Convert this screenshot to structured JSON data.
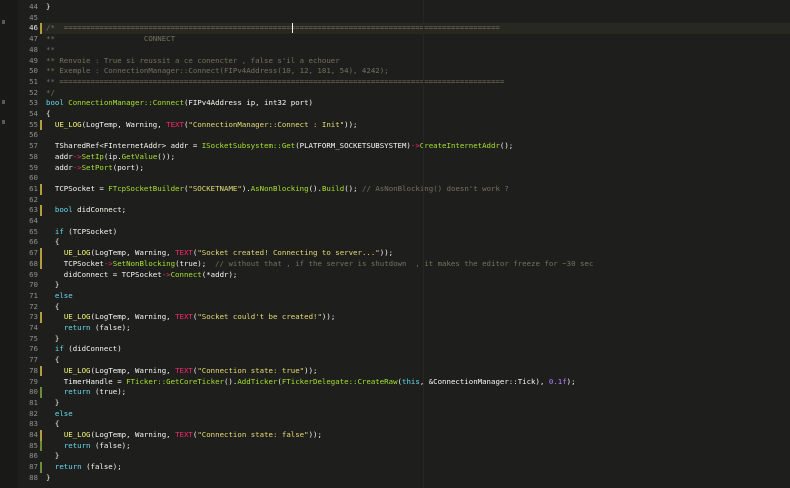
{
  "editor": {
    "active_line": "46",
    "colors": {
      "background": "#1e1f1c",
      "comment": "#75715e",
      "keyword": "#66d9ef",
      "string": "#e6db74",
      "function": "#a6e22e",
      "number": "#ae81ff",
      "operator": "#f92672",
      "line_number": "#8f908a",
      "added_marker": "#6a8e3a"
    },
    "lines": [
      {
        "num": "44",
        "marker": "",
        "tokens": [
          {
            "t": "}",
            "c": "punct"
          }
        ]
      },
      {
        "num": "45",
        "marker": "",
        "tokens": []
      },
      {
        "num": "46",
        "marker": "mod",
        "tokens": [
          {
            "t": "/*  ==================================================================================================",
            "c": "comment"
          }
        ]
      },
      {
        "num": "47",
        "marker": "",
        "tokens": [
          {
            "t": "**                    CONNECT",
            "c": "comment"
          }
        ]
      },
      {
        "num": "48",
        "marker": "",
        "tokens": [
          {
            "t": "**",
            "c": "comment"
          }
        ]
      },
      {
        "num": "49",
        "marker": "",
        "tokens": [
          {
            "t": "** Renvoie : True si reussit a ce conencter , false s'il a echouer",
            "c": "comment"
          }
        ]
      },
      {
        "num": "50",
        "marker": "",
        "tokens": [
          {
            "t": "** Exemple : ConnectionManager::Connect(FIPv4Address(10, 12, 181, 54), 4242);",
            "c": "comment"
          }
        ]
      },
      {
        "num": "51",
        "marker": "",
        "tokens": [
          {
            "t": "** ====================================================================================================",
            "c": "comment"
          }
        ]
      },
      {
        "num": "52",
        "marker": "",
        "tokens": [
          {
            "t": "*/",
            "c": "comment"
          }
        ]
      },
      {
        "num": "53",
        "marker": "",
        "tokens": [
          {
            "t": "bool ",
            "c": "keyword"
          },
          {
            "t": "ConnectionManager::Connect",
            "c": "func"
          },
          {
            "t": "(FIPv4Address ip, int32 port)",
            "c": "default"
          }
        ]
      },
      {
        "num": "54",
        "marker": "",
        "tokens": [
          {
            "t": "{",
            "c": "punct"
          }
        ]
      },
      {
        "num": "55",
        "marker": "mod",
        "tokens": [
          {
            "t": "  ",
            "c": "default"
          },
          {
            "t": "UE_LOG",
            "c": "ue"
          },
          {
            "t": "(LogTemp, Warning, ",
            "c": "default"
          },
          {
            "t": "TEXT",
            "c": "text"
          },
          {
            "t": "(",
            "c": "default"
          },
          {
            "t": "\"ConnectionManager::Connect : Init\"",
            "c": "string"
          },
          {
            "t": "));",
            "c": "default"
          }
        ]
      },
      {
        "num": "56",
        "marker": "",
        "tokens": []
      },
      {
        "num": "57",
        "marker": "",
        "tokens": [
          {
            "t": "  TSharedRef<FInternetAddr> addr = ",
            "c": "default"
          },
          {
            "t": "ISocketSubsystem::Get",
            "c": "func"
          },
          {
            "t": "(PLATFORM_SOCKETSUBSYSTEM)",
            "c": "default"
          },
          {
            "t": "->",
            "c": "op"
          },
          {
            "t": "CreateInternetAddr",
            "c": "func"
          },
          {
            "t": "();",
            "c": "default"
          }
        ]
      },
      {
        "num": "58",
        "marker": "",
        "tokens": [
          {
            "t": "  addr",
            "c": "default"
          },
          {
            "t": "->",
            "c": "op"
          },
          {
            "t": "SetIp",
            "c": "func"
          },
          {
            "t": "(ip.",
            "c": "default"
          },
          {
            "t": "GetValue",
            "c": "func"
          },
          {
            "t": "());",
            "c": "default"
          }
        ]
      },
      {
        "num": "59",
        "marker": "",
        "tokens": [
          {
            "t": "  addr",
            "c": "default"
          },
          {
            "t": "->",
            "c": "op"
          },
          {
            "t": "SetPort",
            "c": "func"
          },
          {
            "t": "(port);",
            "c": "default"
          }
        ]
      },
      {
        "num": "60",
        "marker": "",
        "tokens": []
      },
      {
        "num": "61",
        "marker": "mod",
        "tokens": [
          {
            "t": "  TCPSocket = ",
            "c": "default"
          },
          {
            "t": "FTcpSocketBuilder",
            "c": "func"
          },
          {
            "t": "(",
            "c": "default"
          },
          {
            "t": "\"SOCKETNAME\"",
            "c": "string"
          },
          {
            "t": ").",
            "c": "default"
          },
          {
            "t": "AsNonBlocking",
            "c": "func"
          },
          {
            "t": "().",
            "c": "default"
          },
          {
            "t": "Build",
            "c": "func"
          },
          {
            "t": "(); ",
            "c": "default"
          },
          {
            "t": "// AsNonBlocking() doesn't work ?",
            "c": "comment"
          }
        ]
      },
      {
        "num": "62",
        "marker": "",
        "tokens": []
      },
      {
        "num": "63",
        "marker": "mod",
        "tokens": [
          {
            "t": "  ",
            "c": "default"
          },
          {
            "t": "bool ",
            "c": "keyword"
          },
          {
            "t": "didConnect;",
            "c": "default"
          }
        ]
      },
      {
        "num": "64",
        "marker": "",
        "tokens": []
      },
      {
        "num": "65",
        "marker": "",
        "tokens": [
          {
            "t": "  ",
            "c": "default"
          },
          {
            "t": "if ",
            "c": "keyword"
          },
          {
            "t": "(TCPSocket)",
            "c": "default"
          }
        ]
      },
      {
        "num": "66",
        "marker": "",
        "tokens": [
          {
            "t": "  {",
            "c": "punct"
          }
        ]
      },
      {
        "num": "67",
        "marker": "mod",
        "tokens": [
          {
            "t": "    ",
            "c": "default"
          },
          {
            "t": "UE_LOG",
            "c": "ue"
          },
          {
            "t": "(LogTemp, Warning, ",
            "c": "default"
          },
          {
            "t": "TEXT",
            "c": "text"
          },
          {
            "t": "(",
            "c": "default"
          },
          {
            "t": "\"Socket created! Connecting to server...\"",
            "c": "string"
          },
          {
            "t": "));",
            "c": "default"
          }
        ]
      },
      {
        "num": "68",
        "marker": "mod",
        "tokens": [
          {
            "t": "    TCPSocket",
            "c": "default"
          },
          {
            "t": "->",
            "c": "op"
          },
          {
            "t": "SetNonBlocking",
            "c": "func"
          },
          {
            "t": "(true);  ",
            "c": "default"
          },
          {
            "t": "// without that , if the server is shutdown  , it makes the editor freeze for ~30 sec",
            "c": "comment"
          }
        ]
      },
      {
        "num": "69",
        "marker": "",
        "tokens": [
          {
            "t": "    didConnect = TCPSocket",
            "c": "default"
          },
          {
            "t": "->",
            "c": "op"
          },
          {
            "t": "Connect",
            "c": "func"
          },
          {
            "t": "(*addr);",
            "c": "default"
          }
        ]
      },
      {
        "num": "70",
        "marker": "",
        "tokens": [
          {
            "t": "  }",
            "c": "punct"
          }
        ]
      },
      {
        "num": "71",
        "marker": "",
        "tokens": [
          {
            "t": "  ",
            "c": "default"
          },
          {
            "t": "else",
            "c": "keyword"
          }
        ]
      },
      {
        "num": "72",
        "marker": "",
        "tokens": [
          {
            "t": "  {",
            "c": "punct"
          }
        ]
      },
      {
        "num": "73",
        "marker": "mod",
        "tokens": [
          {
            "t": "    ",
            "c": "default"
          },
          {
            "t": "UE_LOG",
            "c": "ue"
          },
          {
            "t": "(LogTemp, Warning, ",
            "c": "default"
          },
          {
            "t": "TEXT",
            "c": "text"
          },
          {
            "t": "(",
            "c": "default"
          },
          {
            "t": "\"Socket could't be created!\"",
            "c": "string"
          },
          {
            "t": "));",
            "c": "default"
          }
        ]
      },
      {
        "num": "74",
        "marker": "",
        "tokens": [
          {
            "t": "    ",
            "c": "default"
          },
          {
            "t": "return ",
            "c": "keyword"
          },
          {
            "t": "(false);",
            "c": "default"
          }
        ]
      },
      {
        "num": "75",
        "marker": "",
        "tokens": [
          {
            "t": "  }",
            "c": "punct"
          }
        ]
      },
      {
        "num": "76",
        "marker": "",
        "tokens": [
          {
            "t": "  ",
            "c": "default"
          },
          {
            "t": "if ",
            "c": "keyword"
          },
          {
            "t": "(didConnect)",
            "c": "default"
          }
        ]
      },
      {
        "num": "77",
        "marker": "",
        "tokens": [
          {
            "t": "  {",
            "c": "punct"
          }
        ]
      },
      {
        "num": "78",
        "marker": "mod",
        "tokens": [
          {
            "t": "    ",
            "c": "default"
          },
          {
            "t": "UE_LOG",
            "c": "ue"
          },
          {
            "t": "(LogTemp, Warning, ",
            "c": "default"
          },
          {
            "t": "TEXT",
            "c": "text"
          },
          {
            "t": "(",
            "c": "default"
          },
          {
            "t": "\"Connection state: true\"",
            "c": "string"
          },
          {
            "t": "));",
            "c": "default"
          }
        ]
      },
      {
        "num": "79",
        "marker": "",
        "tokens": [
          {
            "t": "    TimerHandle = ",
            "c": "default"
          },
          {
            "t": "FTicker::GetCoreTicker",
            "c": "func"
          },
          {
            "t": "().",
            "c": "default"
          },
          {
            "t": "AddTicker",
            "c": "func"
          },
          {
            "t": "(",
            "c": "default"
          },
          {
            "t": "FTickerDelegate::CreateRaw",
            "c": "func"
          },
          {
            "t": "(",
            "c": "default"
          },
          {
            "t": "this",
            "c": "keyword"
          },
          {
            "t": ", &ConnectionManager::Tick), ",
            "c": "default"
          },
          {
            "t": "0.1f",
            "c": "number"
          },
          {
            "t": ");",
            "c": "default"
          }
        ]
      },
      {
        "num": "80",
        "marker": "add",
        "tokens": [
          {
            "t": "    ",
            "c": "default"
          },
          {
            "t": "return ",
            "c": "keyword"
          },
          {
            "t": "(true);",
            "c": "default"
          }
        ]
      },
      {
        "num": "81",
        "marker": "",
        "tokens": [
          {
            "t": "  }",
            "c": "punct"
          }
        ]
      },
      {
        "num": "82",
        "marker": "",
        "tokens": [
          {
            "t": "  ",
            "c": "default"
          },
          {
            "t": "else",
            "c": "keyword"
          }
        ]
      },
      {
        "num": "83",
        "marker": "",
        "tokens": [
          {
            "t": "  {",
            "c": "punct"
          }
        ]
      },
      {
        "num": "84",
        "marker": "mod",
        "tokens": [
          {
            "t": "    ",
            "c": "default"
          },
          {
            "t": "UE_LOG",
            "c": "ue"
          },
          {
            "t": "(LogTemp, Warning, ",
            "c": "default"
          },
          {
            "t": "TEXT",
            "c": "text"
          },
          {
            "t": "(",
            "c": "default"
          },
          {
            "t": "\"Connection state: false\"",
            "c": "string"
          },
          {
            "t": "));",
            "c": "default"
          }
        ]
      },
      {
        "num": "85",
        "marker": "add",
        "tokens": [
          {
            "t": "    ",
            "c": "default"
          },
          {
            "t": "return ",
            "c": "keyword"
          },
          {
            "t": "(false);",
            "c": "default"
          }
        ]
      },
      {
        "num": "86",
        "marker": "",
        "tokens": [
          {
            "t": "  }",
            "c": "punct"
          }
        ]
      },
      {
        "num": "87",
        "marker": "add",
        "tokens": [
          {
            "t": "  ",
            "c": "default"
          },
          {
            "t": "return ",
            "c": "keyword"
          },
          {
            "t": "(false);",
            "c": "default"
          }
        ]
      },
      {
        "num": "88",
        "marker": "",
        "tokens": [
          {
            "t": "}",
            "c": "punct"
          }
        ]
      }
    ]
  }
}
